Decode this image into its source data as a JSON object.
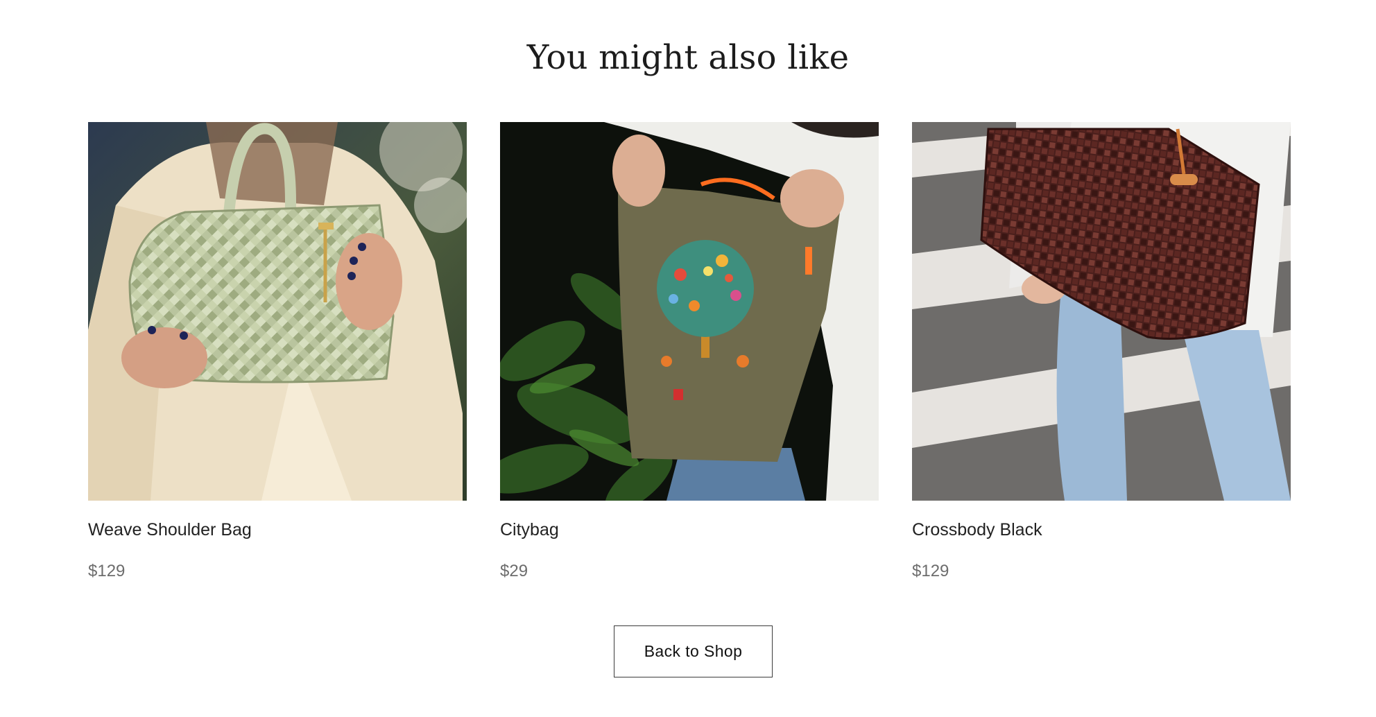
{
  "section": {
    "title": "You might also like"
  },
  "products": [
    {
      "name": "Weave Shoulder Bag",
      "price": "$129",
      "image": "green-woven-handbag-photo"
    },
    {
      "name": "Citybag",
      "price": "$29",
      "image": "olive-embroidered-tree-tote-photo"
    },
    {
      "name": "Crossbody Black",
      "price": "$129",
      "image": "brown-woven-shoulder-bag-photo"
    }
  ],
  "actions": {
    "back_label": "Back to Shop"
  }
}
